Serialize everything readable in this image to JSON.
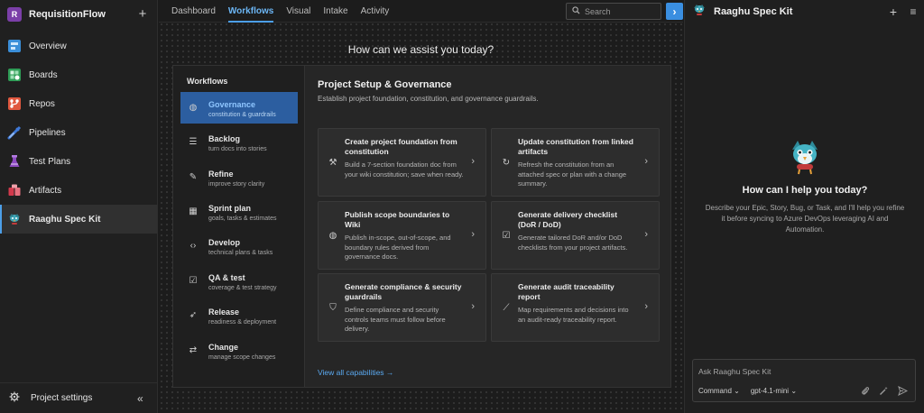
{
  "org": {
    "initial": "R",
    "name": "RequisitionFlow",
    "add_symbol": "+"
  },
  "sidebar": {
    "items": [
      {
        "label": "Overview",
        "icon": "overview-icon",
        "color": "#3b8ed8"
      },
      {
        "label": "Boards",
        "icon": "boards-icon",
        "color": "#2f9d57"
      },
      {
        "label": "Repos",
        "icon": "repos-icon",
        "color": "#e0583f"
      },
      {
        "label": "Pipelines",
        "icon": "pipelines-icon",
        "color": "#3f79d8"
      },
      {
        "label": "Test Plans",
        "icon": "test-plans-icon",
        "color": "#8e4bc2"
      },
      {
        "label": "Artifacts",
        "icon": "artifacts-icon",
        "color": "#d2394c"
      },
      {
        "label": "Raaghu Spec Kit",
        "icon": "spec-kit-icon",
        "color": "#3fa7b8",
        "active": true
      }
    ],
    "settings_label": "Project settings",
    "collapse_symbol": "«"
  },
  "topnav": {
    "tabs": [
      "Dashboard",
      "Workflows",
      "Visual",
      "Intake",
      "Activity"
    ],
    "active": "Workflows",
    "search_placeholder": "Search",
    "expand_symbol": "›"
  },
  "main": {
    "headline": "How can we assist you today?",
    "workflows_title": "Workflows",
    "workflows": [
      {
        "name": "Governance",
        "desc": "constitution & guardrails",
        "icon": "globe-icon",
        "glyph": "◍",
        "active": true
      },
      {
        "name": "Backlog",
        "desc": "turn docs into stories",
        "icon": "list-icon",
        "glyph": "☰"
      },
      {
        "name": "Refine",
        "desc": "improve story clarity",
        "icon": "pencil-icon",
        "glyph": "✎"
      },
      {
        "name": "Sprint plan",
        "desc": "goals, tasks & estimates",
        "icon": "calendar-icon",
        "glyph": "▦"
      },
      {
        "name": "Develop",
        "desc": "technical plans & tasks",
        "icon": "code-icon",
        "glyph": "‹›"
      },
      {
        "name": "QA & test",
        "desc": "coverage & test strategy",
        "icon": "checklist-icon",
        "glyph": "☑"
      },
      {
        "name": "Release",
        "desc": "readiness & deployment",
        "icon": "rocket-icon",
        "glyph": "➶"
      },
      {
        "name": "Change",
        "desc": "manage scope changes",
        "icon": "change-icon",
        "glyph": "⇄"
      }
    ],
    "section_title": "Project Setup & Governance",
    "section_subtitle": "Establish project foundation, constitution, and governance guardrails.",
    "cards": [
      {
        "title": "Create project foundation from constitution",
        "desc": "Build a 7-section foundation doc from your wiki constitution; save when ready.",
        "icon": "hammer-icon",
        "glyph": "⚒"
      },
      {
        "title": "Update constitution from linked artifacts",
        "desc": "Refresh the constitution from an attached spec or plan with a change summary.",
        "icon": "refresh-icon",
        "glyph": "↻"
      },
      {
        "title": "Publish scope boundaries to Wiki",
        "desc": "Publish in-scope, out-of-scope, and boundary rules derived from governance docs.",
        "icon": "globe-icon",
        "glyph": "◍"
      },
      {
        "title": "Generate delivery checklist (DoR / DoD)",
        "desc": "Generate tailored DoR and/or DoD checklists from your project artifacts.",
        "icon": "checklist-icon",
        "glyph": "☑"
      },
      {
        "title": "Generate compliance & security guardrails",
        "desc": "Define compliance and security controls teams must follow before delivery.",
        "icon": "shield-icon",
        "glyph": "⛉"
      },
      {
        "title": "Generate audit traceability report",
        "desc": "Map requirements and decisions into an audit-ready traceability report.",
        "icon": "trend-icon",
        "glyph": "⟋"
      }
    ],
    "chevron": "›",
    "view_all": "View all capabilities →"
  },
  "chat": {
    "title": "Raaghu Spec Kit",
    "plus": "+",
    "menu": "≡",
    "help_title": "How can I help you today?",
    "help_text": "Describe your Epic, Story, Bug, or Task, and I'll help you refine it before syncing to Azure DevOps leveraging AI and Automation.",
    "input_placeholder": "Ask Raaghu Spec Kit",
    "mode": "Command",
    "model": "gpt-4.1-mini",
    "dropdown": "⌄"
  }
}
